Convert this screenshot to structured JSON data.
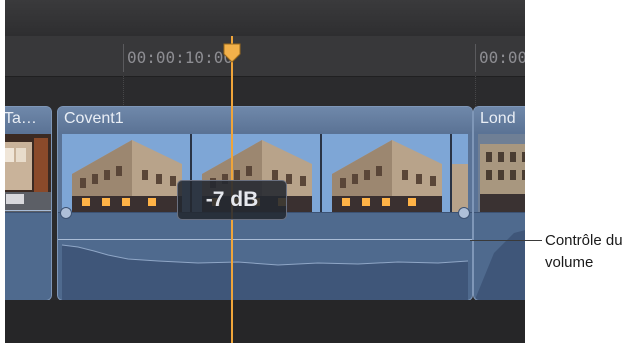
{
  "ruler": {
    "timecodes": [
      "00:00:10:00",
      "00:00"
    ]
  },
  "clips": [
    {
      "title": "Ta…",
      "scene": "storefront"
    },
    {
      "title": "Covent1",
      "scene": "building"
    },
    {
      "title": "Lond",
      "scene": "building"
    }
  ],
  "volume_tooltip": "-7 dB",
  "callout": {
    "label": "Contrôle du volume"
  },
  "colors": {
    "playhead": "#f0a53a",
    "clip_body": "#5a7396",
    "clip_audio": "#4f6a8e",
    "background": "#2b2b2d"
  },
  "icons": [
    "playhead-marker-icon",
    "volume-keyframe-icon"
  ]
}
